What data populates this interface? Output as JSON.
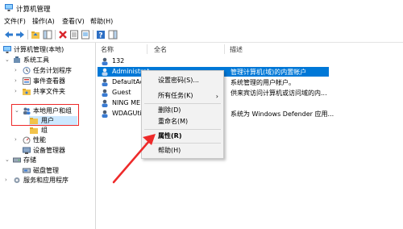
{
  "window": {
    "title": "计算机管理"
  },
  "menu": [
    "文件(F)",
    "操作(A)",
    "查看(V)",
    "帮助(H)"
  ],
  "toolbar_icons": [
    "back-icon",
    "forward-icon",
    "up-folder-icon",
    "show-tree-icon",
    "delete-icon",
    "properties-icon",
    "export-list-icon",
    "help-icon",
    "action-pane-icon"
  ],
  "tree": {
    "root": "计算机管理(本地)",
    "system_tools": "系统工具",
    "task_scheduler": "任务计划程序",
    "event_viewer": "事件查看器",
    "shared_folders": "共享文件夹",
    "local_users": "本地用户和组",
    "users": "用户",
    "groups": "组",
    "performance": "性能",
    "device_manager": "设备管理器",
    "storage": "存储",
    "disk_management": "磁盘管理",
    "services": "服务和应用程序"
  },
  "list": {
    "columns": [
      "名称",
      "全名",
      "描述"
    ],
    "rows": [
      {
        "name": "132",
        "fullname": "",
        "desc": ""
      },
      {
        "name": "Administrat",
        "fullname": "",
        "desc": "管理计算机(域)的内置帐户"
      },
      {
        "name": "DefaultAcc",
        "fullname": "",
        "desc": "系统管理的用户帐户。"
      },
      {
        "name": "Guest",
        "fullname": "",
        "desc": "供来宾访问计算机或访问域的内..."
      },
      {
        "name": "NING ME",
        "fullname": "",
        "desc": ""
      },
      {
        "name": "WDAGUtil",
        "fullname": "",
        "desc": "系统为 Windows Defender 应用..."
      }
    ]
  },
  "context_menu": {
    "set_password": "设置密码(S)...",
    "all_tasks": "所有任务(K)",
    "delete": "删除(D)",
    "rename": "重命名(M)",
    "properties": "属性(R)",
    "help": "帮助(H)"
  },
  "colors": {
    "selection": "#0078d7",
    "highlight": "#cce8ff",
    "annotation": "#ee2a2a"
  }
}
